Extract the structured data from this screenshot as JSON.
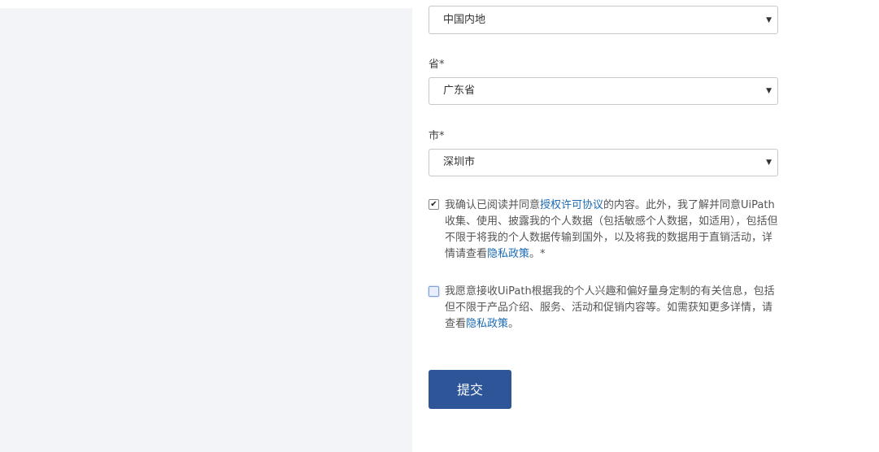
{
  "country": {
    "selected": "中国内地"
  },
  "province": {
    "label": "省*",
    "selected": "广东省"
  },
  "city": {
    "label": "市*",
    "selected": "深圳市"
  },
  "consent_terms": {
    "text_1": "我确认已阅读并同意",
    "link_license": "授权许可协议",
    "text_2": "的内容。此外，我了解并同意UiPath收集、使用、披露我的个人数据（包括敏感个人数据，如适用），包括但不限于将我的个人数据传输到国外，以及将我的数据用于直销活动，详情请查看",
    "link_privacy": "隐私政策",
    "text_3": "。*",
    "checked": true
  },
  "consent_marketing": {
    "text_1": "我愿意接收UiPath根据我的个人兴趣和偏好量身定制的有关信息，包括但不限于产品介绍、服务、活动和促销内容等。如需获知更多详情，请查看",
    "link_privacy": "隐私政策",
    "text_2": "。",
    "checked": false
  },
  "submit": {
    "label": "提交"
  },
  "icons": {
    "caret": "caret-down-icon",
    "check": "check-icon"
  }
}
